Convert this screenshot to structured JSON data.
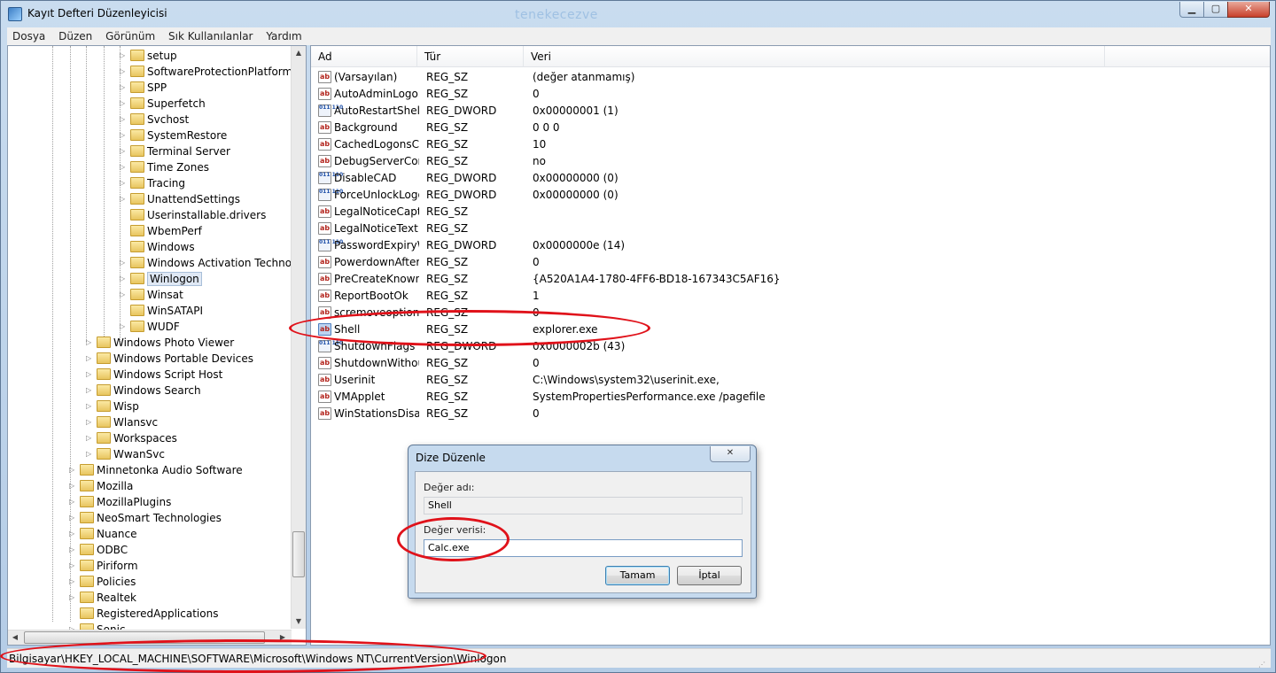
{
  "window": {
    "title": "Kayıt Defteri Düzenleyicisi",
    "watermark": "tenekecezve",
    "controls": {
      "minimize": "▁",
      "maximize": "▢",
      "close": "✕"
    }
  },
  "menu": [
    "Dosya",
    "Düzen",
    "Görünüm",
    "Sık Kullanılanlar",
    "Yardım"
  ],
  "tree": {
    "level3": [
      "setup",
      "SoftwareProtectionPlatform",
      "SPP",
      "Superfetch",
      "Svchost",
      "SystemRestore",
      "Terminal Server",
      "Time Zones",
      "Tracing",
      "UnattendSettings",
      "Userinstallable.drivers",
      "WbemPerf",
      "Windows",
      "Windows Activation Technologies",
      "Winlogon",
      "Winsat",
      "WinSATAPI",
      "WUDF"
    ],
    "level2": [
      "Windows Photo Viewer",
      "Windows Portable Devices",
      "Windows Script Host",
      "Windows Search",
      "Wisp",
      "Wlansvc",
      "Workspaces",
      "WwanSvc"
    ],
    "level1": [
      "Minnetonka Audio Software",
      "Mozilla",
      "MozillaPlugins",
      "NeoSmart Technologies",
      "Nuance",
      "ODBC",
      "Piriform",
      "Policies",
      "Realtek",
      "RegisteredApplications",
      "Sonic"
    ]
  },
  "list": {
    "headers": {
      "name": "Ad",
      "type": "Tür",
      "data": "Veri"
    },
    "rows": [
      {
        "icon": "ab",
        "name": "(Varsayılan)",
        "type": "REG_SZ",
        "data": "(değer atanmamış)"
      },
      {
        "icon": "ab",
        "name": "AutoAdminLogon",
        "type": "REG_SZ",
        "data": "0"
      },
      {
        "icon": "dw",
        "name": "AutoRestartShell",
        "type": "REG_DWORD",
        "data": "0x00000001 (1)"
      },
      {
        "icon": "ab",
        "name": "Background",
        "type": "REG_SZ",
        "data": "0 0 0"
      },
      {
        "icon": "ab",
        "name": "CachedLogonsCount",
        "type": "REG_SZ",
        "data": "10"
      },
      {
        "icon": "ab",
        "name": "DebugServerCommand",
        "type": "REG_SZ",
        "data": "no"
      },
      {
        "icon": "dw",
        "name": "DisableCAD",
        "type": "REG_DWORD",
        "data": "0x00000000 (0)"
      },
      {
        "icon": "dw",
        "name": "ForceUnlockLogon",
        "type": "REG_DWORD",
        "data": "0x00000000 (0)"
      },
      {
        "icon": "ab",
        "name": "LegalNoticeCaption",
        "type": "REG_SZ",
        "data": ""
      },
      {
        "icon": "ab",
        "name": "LegalNoticeText",
        "type": "REG_SZ",
        "data": ""
      },
      {
        "icon": "dw",
        "name": "PasswordExpiryWarning",
        "type": "REG_DWORD",
        "data": "0x0000000e (14)"
      },
      {
        "icon": "ab",
        "name": "PowerdownAfterShutdown",
        "type": "REG_SZ",
        "data": "0"
      },
      {
        "icon": "ab",
        "name": "PreCreateKnownFolders",
        "type": "REG_SZ",
        "data": "{A520A1A4-1780-4FF6-BD18-167343C5AF16}"
      },
      {
        "icon": "ab",
        "name": "ReportBootOk",
        "type": "REG_SZ",
        "data": "1"
      },
      {
        "icon": "ab",
        "name": "scremoveoption",
        "type": "REG_SZ",
        "data": "0"
      },
      {
        "icon": "ab",
        "name": "Shell",
        "type": "REG_SZ",
        "data": "explorer.exe"
      },
      {
        "icon": "dw",
        "name": "ShutdownFlags",
        "type": "REG_DWORD",
        "data": "0x0000002b (43)"
      },
      {
        "icon": "ab",
        "name": "ShutdownWithoutLogon",
        "type": "REG_SZ",
        "data": "0"
      },
      {
        "icon": "ab",
        "name": "Userinit",
        "type": "REG_SZ",
        "data": "C:\\Windows\\system32\\userinit.exe,"
      },
      {
        "icon": "ab",
        "name": "VMApplet",
        "type": "REG_SZ",
        "data": "SystemPropertiesPerformance.exe /pagefile"
      },
      {
        "icon": "ab",
        "name": "WinStationsDisabled",
        "type": "REG_SZ",
        "data": "0"
      }
    ]
  },
  "status": {
    "path": "Bilgisayar\\HKEY_LOCAL_MACHINE\\SOFTWARE\\Microsoft\\Windows NT\\CurrentVersion\\Winlogon"
  },
  "dialog": {
    "title": "Dize Düzenle",
    "value_name_label": "Değer adı:",
    "value_name": "Shell",
    "value_data_label": "Değer verisi:",
    "value_data": "Calc.exe",
    "ok": "Tamam",
    "cancel": "İptal",
    "close": "✕"
  },
  "colors": {
    "highlight_oval": "#e0121a",
    "accent": "#3c7fb1"
  }
}
